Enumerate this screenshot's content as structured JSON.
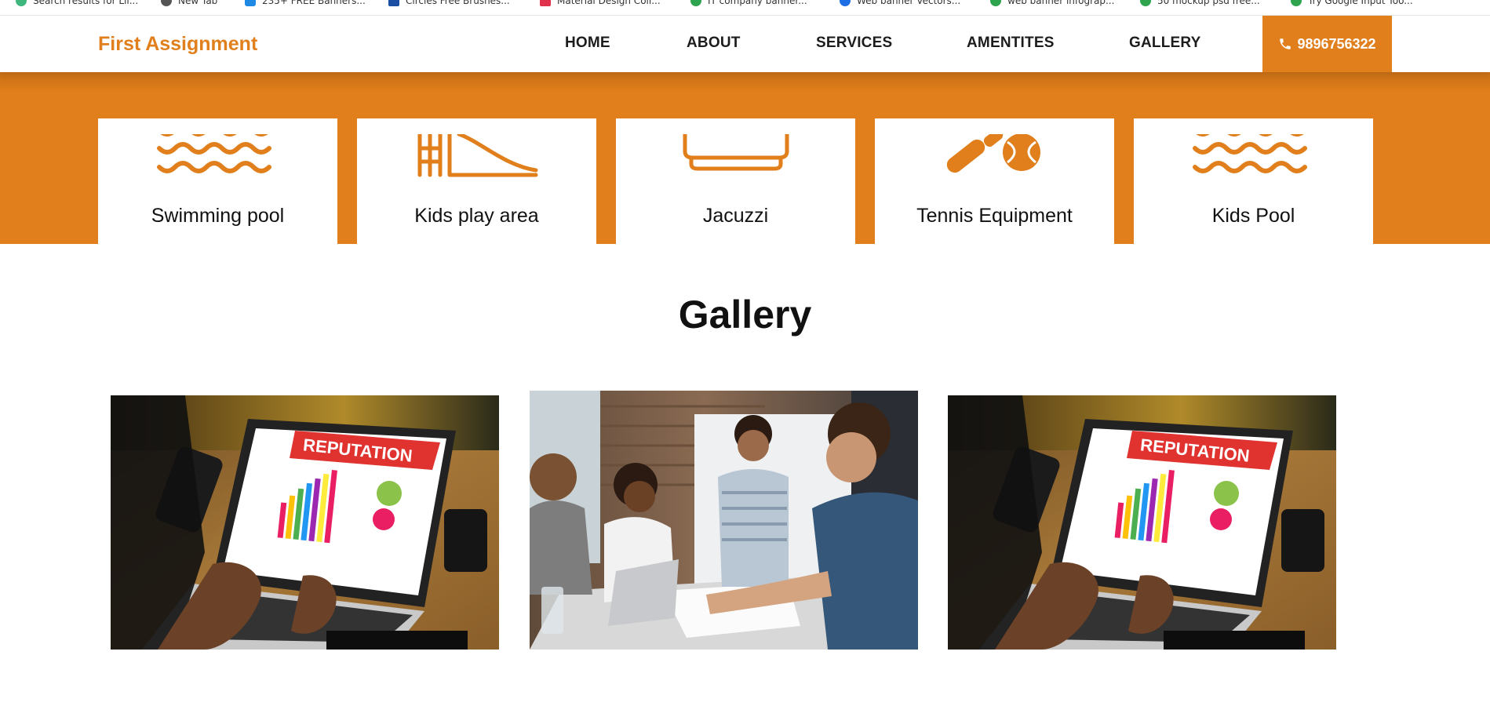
{
  "bookmarks": [
    {
      "label": "Search results for Lil...",
      "color": "#3fb67b"
    },
    {
      "label": "New Tab",
      "color": "#555555"
    },
    {
      "label": "235+ FREE Banners...",
      "color": "#1e88e5"
    },
    {
      "label": "Circles Free Brushes...",
      "color": "#1a4fa3"
    },
    {
      "label": "Material Design Coll...",
      "color": "#e0324d"
    },
    {
      "label": "IT company banner...",
      "color": "#2ea44f"
    },
    {
      "label": "Web banner Vectors...",
      "color": "#1e6ee5"
    },
    {
      "label": "web banner infograp...",
      "color": "#2ea44f"
    },
    {
      "label": "50 mockup psd free...",
      "color": "#2ea44f"
    },
    {
      "label": "Try Google Input Too...",
      "color": "#2ea44f"
    }
  ],
  "navbar": {
    "brand": "First Assignment",
    "items": [
      "HOME",
      "ABOUT",
      "SERVICES",
      "AMENTITES",
      "GALLERY"
    ],
    "phone": "9896756322"
  },
  "amenities": [
    {
      "label": "Swimming pool",
      "icon": "waves-icon"
    },
    {
      "label": "Kids play area",
      "icon": "slide-icon"
    },
    {
      "label": "Jacuzzi",
      "icon": "jacuzzi-icon"
    },
    {
      "label": "Tennis Equipment",
      "icon": "tennis-icon"
    },
    {
      "label": "Kids Pool",
      "icon": "waves-icon"
    }
  ],
  "gallery": {
    "title": "Gallery",
    "images": [
      {
        "kind": "laptop",
        "screen_text": "REPUTATION"
      },
      {
        "kind": "meeting"
      },
      {
        "kind": "laptop",
        "screen_text": "REPUTATION"
      }
    ]
  },
  "colors": {
    "accent": "#e07f1b"
  }
}
